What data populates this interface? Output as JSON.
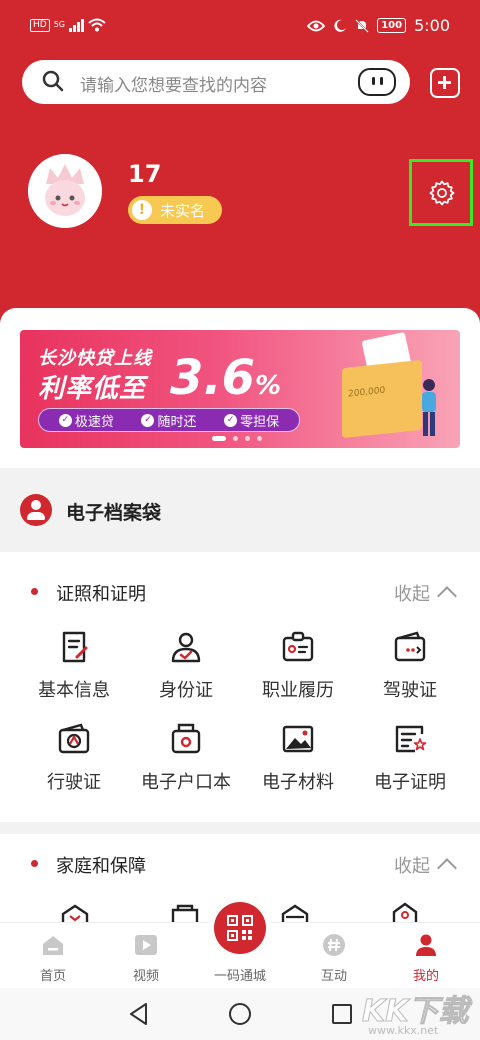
{
  "status_bar": {
    "network": "HD",
    "signal": "5G",
    "battery": "100",
    "time": "5:00"
  },
  "search": {
    "placeholder": "请输入您想要查找的内容"
  },
  "profile": {
    "name": "17",
    "verify_status": "未实名",
    "verify_mark": "!"
  },
  "banner": {
    "title_line1": "长沙快贷上线",
    "title_line2": "利率低至",
    "rate": "3.6",
    "rate_unit": "%",
    "tags": [
      "极速贷",
      "随时还",
      "零担保"
    ],
    "box_label": "200,000"
  },
  "archive": {
    "title": "电子档案袋"
  },
  "sections": [
    {
      "title": "证照和证明",
      "collapse_label": "收起",
      "items": [
        {
          "label": "基本信息",
          "icon": "document-pen-icon"
        },
        {
          "label": "身份证",
          "icon": "id-person-icon"
        },
        {
          "label": "职业履历",
          "icon": "badge-icon"
        },
        {
          "label": "驾驶证",
          "icon": "license-card-icon"
        },
        {
          "label": "行驶证",
          "icon": "vehicle-card-icon"
        },
        {
          "label": "电子户口本",
          "icon": "household-book-icon"
        },
        {
          "label": "电子材料",
          "icon": "image-material-icon"
        },
        {
          "label": "电子证明",
          "icon": "certificate-star-icon"
        }
      ]
    },
    {
      "title": "家庭和保障",
      "collapse_label": "收起"
    }
  ],
  "tabbar": {
    "tabs": [
      {
        "label": "首页",
        "icon": "home-icon"
      },
      {
        "label": "视频",
        "icon": "video-icon"
      },
      {
        "label": "一码通城",
        "icon": "qr-code-icon"
      },
      {
        "label": "互动",
        "icon": "hashtag-chat-icon"
      },
      {
        "label": "我的",
        "icon": "user-icon"
      }
    ],
    "active": "我的"
  },
  "watermark": {
    "text": "KK下载",
    "url": "www.kkx.net"
  },
  "colors": {
    "brand_red": "#d0282e",
    "badge_yellow": "#f8c952",
    "highlight_green": "#36ea27"
  }
}
